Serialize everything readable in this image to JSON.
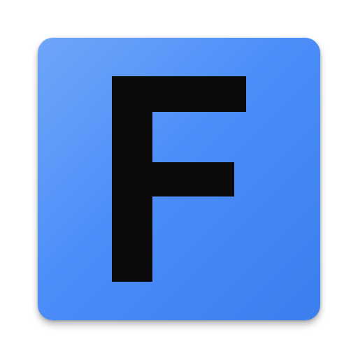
{
  "app_icon": {
    "letter": "F",
    "background_color": "#4a8df9",
    "letter_color": "#0b0b0b"
  }
}
